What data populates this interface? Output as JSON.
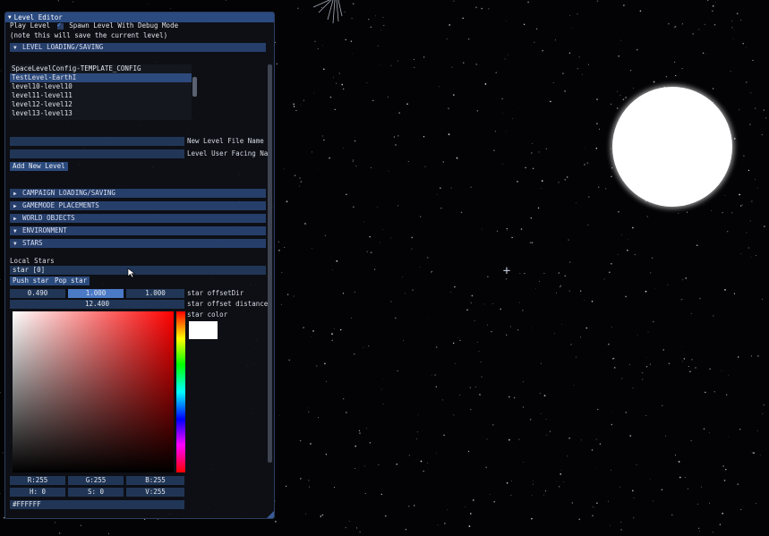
{
  "window": {
    "title": "Level Editor",
    "play_level": "Play Level",
    "spawn_debug": "Spawn Level With Debug Mode",
    "note": "(note this will save the current level)"
  },
  "sections": {
    "level_loading": "LEVEL LOADING/SAVING",
    "campaign": "CAMPAIGN LOADING/SAVING",
    "gamemode": "GAMEMODE PLACEMENTS",
    "world_objects": "WORLD OBJECTS",
    "environment": "ENVIRONMENT",
    "stars": "STARS"
  },
  "level_list": [
    "SpaceLevelConfig-TEMPLATE_CONFIG",
    "TestLevel-EarthI",
    "level10-level10",
    "level11-level11",
    "level12-level12",
    "level13-level13"
  ],
  "level_list_selected_index": 1,
  "new_level": {
    "file_name_label": "New Level File Name",
    "user_facing_label": "Level User Facing Nam",
    "add_button": "Add New Level"
  },
  "stars": {
    "local_stars_label": "Local Stars",
    "current_star": "star [0]",
    "push_button": "Push star",
    "pop_button": "Pop star",
    "offset_dir": [
      "0.490",
      "1.000",
      "1.000"
    ],
    "offset_dir_label": "star offsetDir",
    "offset_distance": "12.400",
    "offset_distance_label": "star offset distance",
    "color_label": "star color"
  },
  "color_picker": {
    "r": "R:255",
    "g": "G:255",
    "b": "B:255",
    "h": "H:  0",
    "s": "S:  0",
    "v": "V:255",
    "hex": "#FFFFFF",
    "swatch_color": "#ffffff"
  },
  "colors": {
    "accent": "#2a4a80",
    "header": "#263e6a",
    "field": "#213656",
    "background": "#030305"
  }
}
